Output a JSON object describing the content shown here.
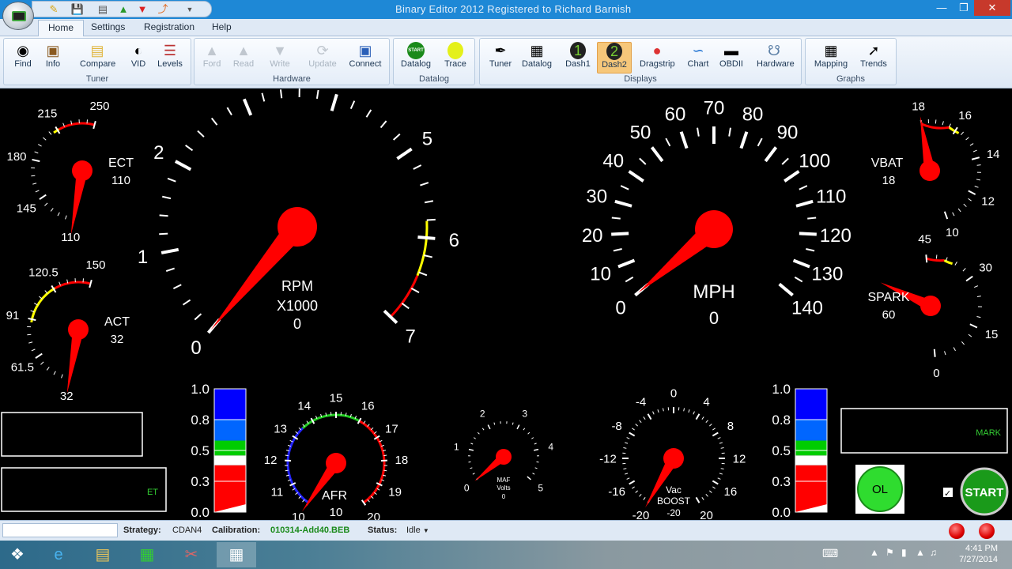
{
  "window": {
    "title": "Binary Editor 2012 Registered to Richard Barnish"
  },
  "tabs": [
    "Home",
    "Settings",
    "Registration",
    "Help"
  ],
  "ribbon": {
    "tuner": {
      "label": "Tuner",
      "buttons": [
        "Find",
        "Info",
        "Compare",
        "VID",
        "Levels"
      ]
    },
    "hardware": {
      "label": "Hardware",
      "buttons": [
        "Ford",
        "Read",
        "Write",
        "Update",
        "Connect"
      ]
    },
    "datalog": {
      "label": "Datalog",
      "buttons": [
        "Datalog",
        "Trace"
      ],
      "start_icon_text": "START"
    },
    "displays": {
      "label": "Displays",
      "buttons": [
        "Tuner",
        "Datalog",
        "Dash1",
        "Dash2",
        "Dragstrip",
        "Chart",
        "OBDII",
        "Hardware"
      ]
    },
    "graphs": {
      "label": "Graphs",
      "buttons": [
        "Mapping",
        "Trends"
      ]
    }
  },
  "gauges": {
    "rpm": {
      "label": "RPM",
      "sub": "X1000",
      "value": "0",
      "ticks": [
        "0",
        "1",
        "2",
        "3",
        "4",
        "5",
        "6",
        "7"
      ]
    },
    "mph": {
      "label": "MPH",
      "value": "0",
      "ticks": [
        "0",
        "10",
        "20",
        "30",
        "40",
        "50",
        "60",
        "70",
        "80",
        "90",
        "100",
        "110",
        "120",
        "130",
        "140"
      ]
    },
    "ect": {
      "label": "ECT",
      "value": "110",
      "ticks": [
        "110",
        "145",
        "180",
        "215",
        "250"
      ]
    },
    "act": {
      "label": "ACT",
      "value": "32",
      "ticks": [
        "32",
        "61.5",
        "91",
        "120.5",
        "150"
      ]
    },
    "vbat": {
      "label": "VBAT",
      "value": "18",
      "ticks": [
        "10",
        "12",
        "14",
        "16",
        "18"
      ]
    },
    "spark": {
      "label": "SPARK",
      "value": "60",
      "ticks": [
        "0",
        "15",
        "30",
        "45"
      ]
    },
    "afr": {
      "label": "AFR",
      "value": "10",
      "ticks": [
        "10",
        "11",
        "12",
        "13",
        "14",
        "15",
        "16",
        "17",
        "18",
        "19",
        "20"
      ]
    },
    "maf": {
      "label": "MAF",
      "sub": "Volts",
      "value": "0",
      "ticks": [
        "0",
        "1",
        "2",
        "3",
        "4",
        "5"
      ]
    },
    "boost": {
      "label": "Vac",
      "sub": "BOOST",
      "value": "-20",
      "ticks": [
        "-20",
        "-16",
        "-12",
        "-8",
        "-4",
        "0",
        "4",
        "8",
        "12",
        "16",
        "20"
      ]
    },
    "bar_scale": [
      "1.0",
      "0.8",
      "0.5",
      "0.3",
      "0.0"
    ]
  },
  "boxes": {
    "et": "ET",
    "mark": "MARK"
  },
  "buttons": {
    "ol": "OL",
    "start": "START"
  },
  "status": {
    "strategy_label": "Strategy:",
    "strategy": "CDAN4",
    "calibration_label": "Calibration:",
    "calibration": "010314-Add40.BEB",
    "status_label": "Status:",
    "status": "Idle"
  },
  "clock": {
    "time": "4:41 PM",
    "date": "7/27/2014"
  }
}
